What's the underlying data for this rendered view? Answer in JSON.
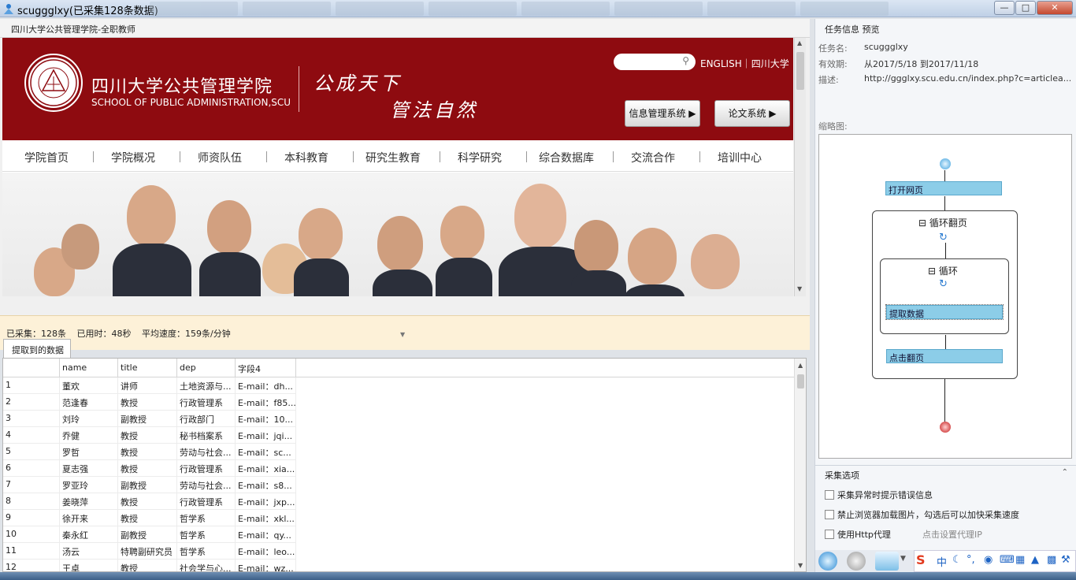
{
  "window": {
    "title": "scuggglxy(已采集128条数据)"
  },
  "browser": {
    "page_title": "四川大学公共管理学院-全职教师",
    "site": {
      "school_cn": "四川大学公共管理学院",
      "school_en": "SCHOOL OF PUBLIC ADMINISTRATION,SCU",
      "motto_line1": "公成天下",
      "motto_line2": "管法自然",
      "search_icon": "magnifier-icon",
      "top_links": "ENGLISH｜四川大学",
      "btn_info": "信息管理系统",
      "btn_thesis": "论文系统",
      "nav": [
        "学院首页",
        "学院概况",
        "师资队伍",
        "本科教育",
        "研究生教育",
        "科学研究",
        "综合数据库",
        "交流合作",
        "培训中心"
      ]
    }
  },
  "status": {
    "collected": "已采集：128条",
    "elapsed": "已用时：48秒",
    "speed": "平均速度：159条/分钟"
  },
  "grid": {
    "tab_label": "提取到的数据",
    "columns": [
      "",
      "name",
      "title",
      "dep",
      "字段4"
    ],
    "rows": [
      [
        "1",
        "董欢",
        "讲师",
        "土地资源与...",
        "E-mail：dh..."
      ],
      [
        "2",
        "范逢春",
        "教授",
        "行政管理系",
        "E-mail：f85..."
      ],
      [
        "3",
        "刘玲",
        "副教授",
        "行政部门",
        "E-mail：10..."
      ],
      [
        "4",
        "乔健",
        "教授",
        "秘书档案系",
        "E-mail：jqi..."
      ],
      [
        "5",
        "罗哲",
        "教授",
        "劳动与社会...",
        "E-mail：sc..."
      ],
      [
        "6",
        "夏志强",
        "教授",
        "行政管理系",
        "E-mail：xia..."
      ],
      [
        "7",
        "罗亚玲",
        "副教授",
        "劳动与社会...",
        "E-mail：s8..."
      ],
      [
        "8",
        "姜晓萍",
        "教授",
        "行政管理系",
        "E-mail：jxp..."
      ],
      [
        "9",
        "徐开来",
        "教授",
        "哲学系",
        "E-mail：xkl..."
      ],
      [
        "10",
        "秦永红",
        "副教授",
        "哲学系",
        "E-mail：qy..."
      ],
      [
        "11",
        "汤云",
        "特聘副研究员",
        "哲学系",
        "E-mail：leo..."
      ],
      [
        "12",
        "王卓",
        "教授",
        "社会学与心...",
        "E-mail：wz..."
      ]
    ]
  },
  "task": {
    "panel_title": "任务信息 预览",
    "name_label": "任务名:",
    "name_value": "scuggglxy",
    "valid_label": "有效期:",
    "valid_value": "从2017/5/18 到2017/11/18",
    "desc_label": "描述:",
    "desc_value": "http://ggglxy.scu.edu.cn/index.php?c=articlea...",
    "thumb_label": "缩略图:"
  },
  "flow": {
    "open_page": "打开网页",
    "loop_page": "循环翻页",
    "loop": "循环",
    "extract": "提取数据",
    "click_next": "点击翻页",
    "collapse_icon": "minus-box-icon",
    "loop_icon": "refresh-icon"
  },
  "options": {
    "title": "采集选项",
    "opt1": "采集异常时提示错误信息",
    "opt2": "禁止浏览器加载图片，勾选后可以加快采集速度",
    "opt3": "使用Http代理",
    "proxy_link": "点击设置代理IP"
  },
  "colors": {
    "brand_red": "#8e0b10",
    "flow_node": "#8ccde8",
    "status_bg": "#fdf1d8"
  }
}
